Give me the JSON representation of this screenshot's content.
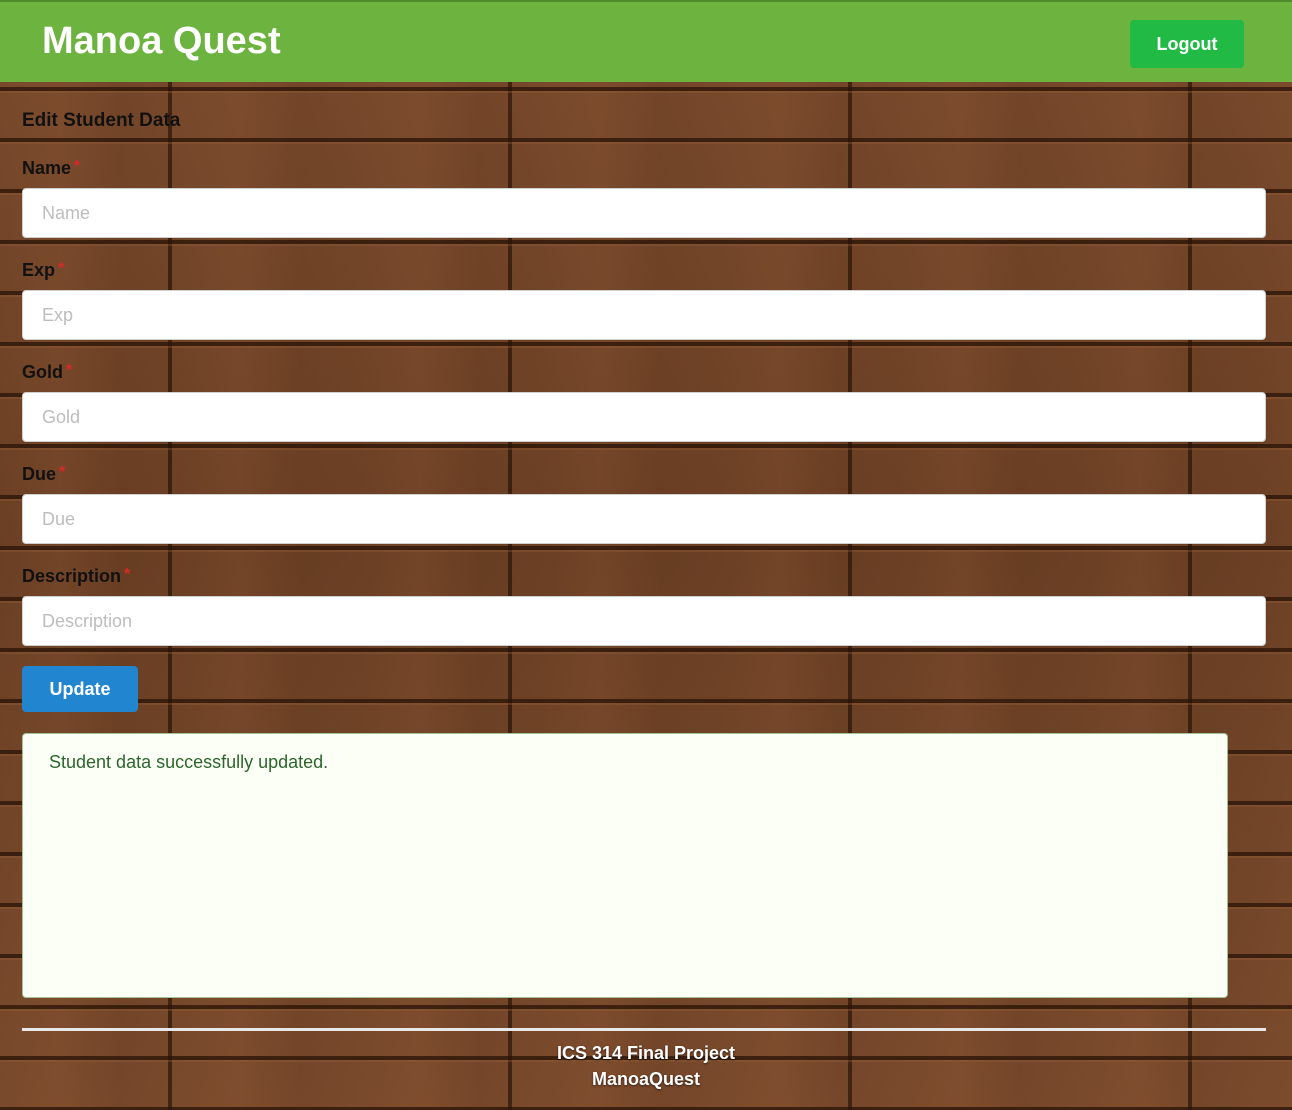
{
  "header": {
    "brand": "Manoa Quest",
    "logout_label": "Logout"
  },
  "form": {
    "title": "Edit Student Data",
    "required_marker": "*",
    "fields": [
      {
        "label": "Name",
        "placeholder": "Name",
        "value": ""
      },
      {
        "label": "Exp",
        "placeholder": "Exp",
        "value": ""
      },
      {
        "label": "Gold",
        "placeholder": "Gold",
        "value": ""
      },
      {
        "label": "Due",
        "placeholder": "Due",
        "value": ""
      },
      {
        "label": "Description",
        "placeholder": "Description",
        "value": ""
      }
    ],
    "submit_label": "Update"
  },
  "message": {
    "text": "Student data successfully updated."
  },
  "footer": {
    "line1": "ICS 314 Final Project",
    "line2": "ManoaQuest"
  },
  "colors": {
    "header_bg": "#6db33f",
    "logout_bg": "#21ba45",
    "update_bg": "#2185d0",
    "success_text": "#2c662d",
    "required": "#db2828"
  }
}
